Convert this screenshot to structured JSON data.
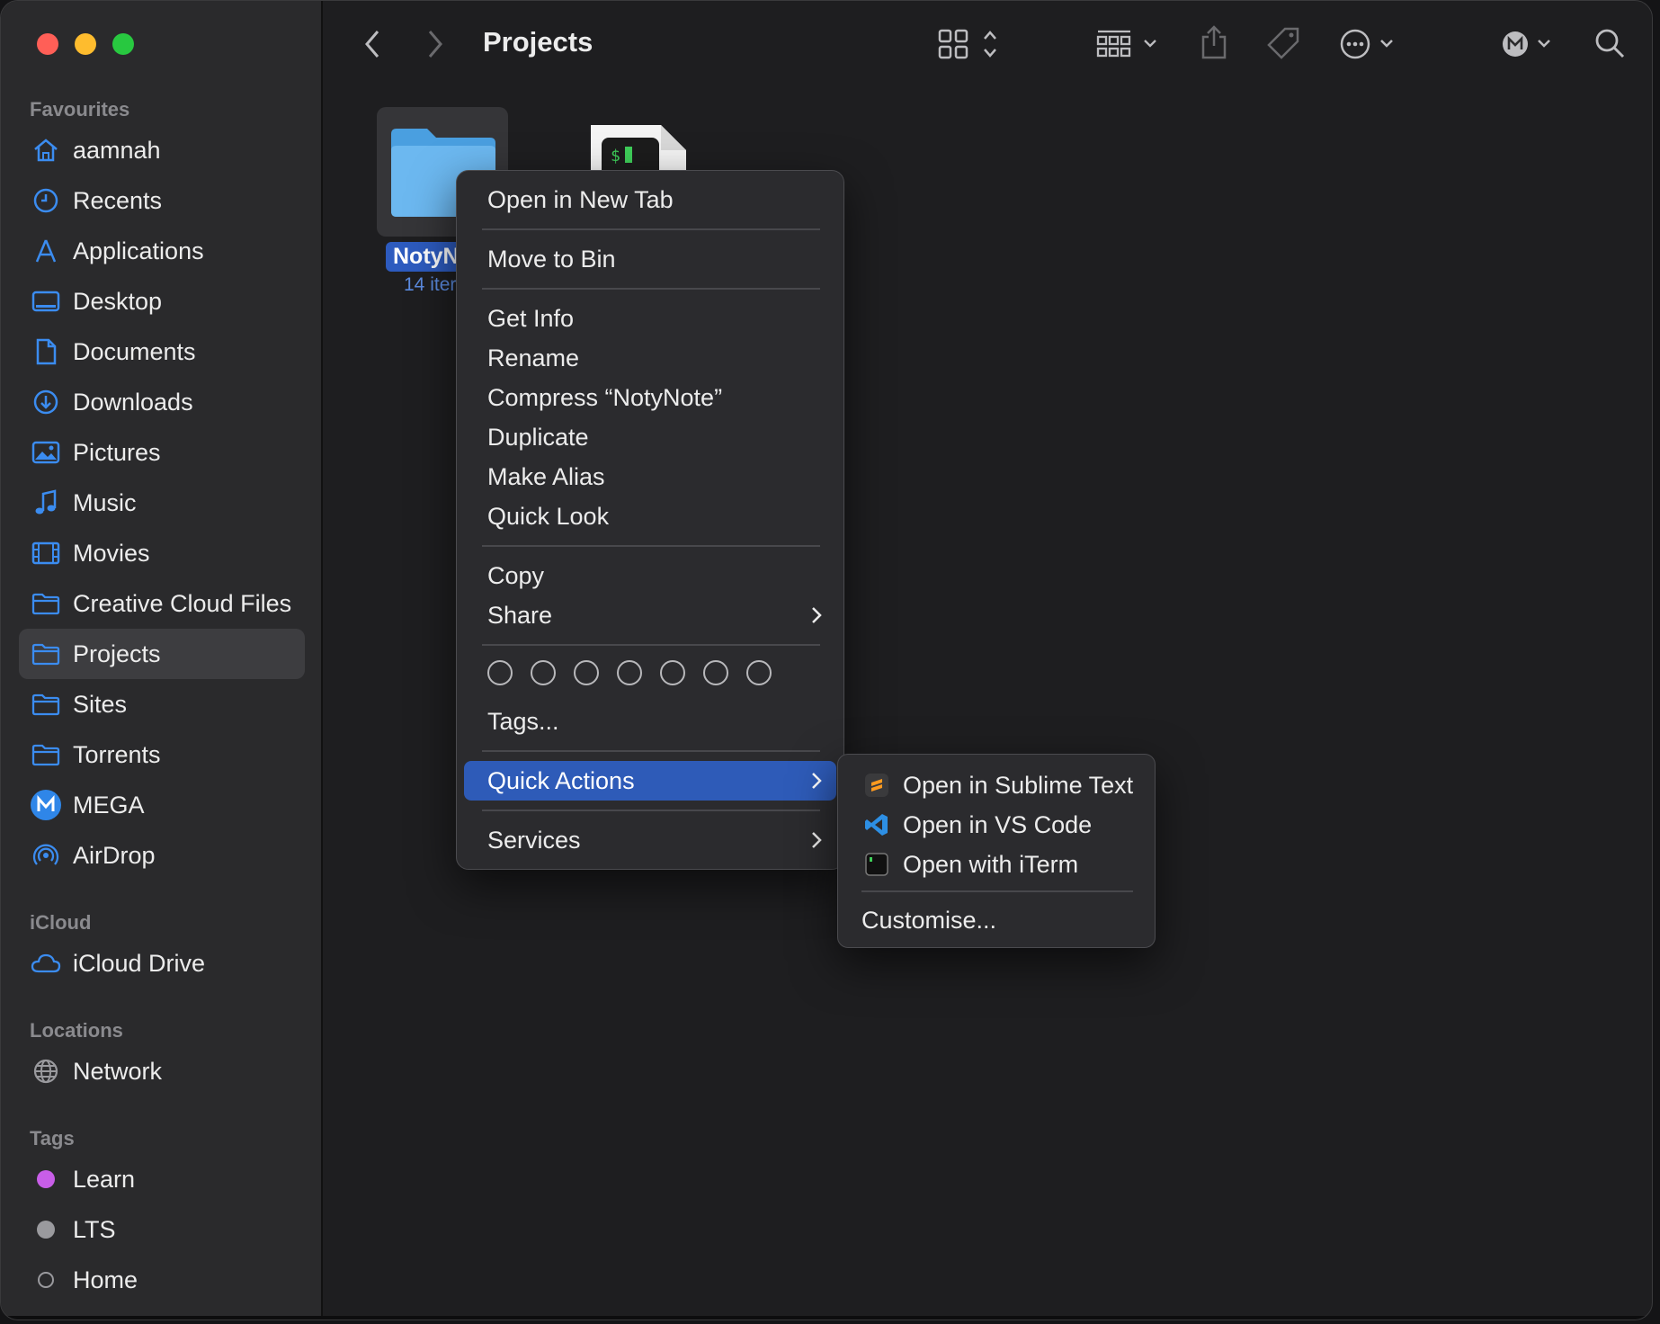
{
  "window": {
    "title": "Projects"
  },
  "sidebar": {
    "sections": {
      "favourites": "Favourites",
      "icloud": "iCloud",
      "locations": "Locations",
      "tags": "Tags"
    },
    "favourites": [
      {
        "label": "aamnah",
        "icon": "house-icon"
      },
      {
        "label": "Recents",
        "icon": "clock-icon"
      },
      {
        "label": "Applications",
        "icon": "applications-icon"
      },
      {
        "label": "Desktop",
        "icon": "desktop-icon"
      },
      {
        "label": "Documents",
        "icon": "document-icon"
      },
      {
        "label": "Downloads",
        "icon": "download-icon"
      },
      {
        "label": "Pictures",
        "icon": "photo-icon"
      },
      {
        "label": "Music",
        "icon": "music-note-icon"
      },
      {
        "label": "Movies",
        "icon": "film-icon"
      },
      {
        "label": "Creative Cloud Files",
        "icon": "folder-icon"
      },
      {
        "label": "Projects",
        "icon": "folder-icon",
        "selected": true
      },
      {
        "label": "Sites",
        "icon": "folder-icon"
      },
      {
        "label": "Torrents",
        "icon": "folder-icon"
      },
      {
        "label": "MEGA",
        "icon": "mega-icon"
      },
      {
        "label": "AirDrop",
        "icon": "airdrop-icon"
      }
    ],
    "icloud": [
      {
        "label": "iCloud Drive",
        "icon": "cloud-icon"
      }
    ],
    "locations": [
      {
        "label": "Network",
        "icon": "globe-icon"
      }
    ],
    "tags": [
      {
        "label": "Learn",
        "color": "#c85ee8"
      },
      {
        "label": "LTS",
        "color": "#9a9a9e"
      },
      {
        "label": "Home",
        "color": ""
      }
    ]
  },
  "toolbar": {
    "title": "Projects",
    "icons": [
      "back-icon",
      "forward-icon",
      "grid-view-icon",
      "group-icon",
      "share-icon",
      "tag-icon",
      "more-icon",
      "mega-toolbar-icon",
      "search-icon"
    ]
  },
  "content": {
    "folder": {
      "name": "NotyN",
      "count": "14 iter"
    }
  },
  "context_menu": {
    "items": {
      "open_new_tab": "Open in New Tab",
      "move_to_bin": "Move to Bin",
      "get_info": "Get Info",
      "rename": "Rename",
      "compress": "Compress “NotyNote”",
      "duplicate": "Duplicate",
      "make_alias": "Make Alias",
      "quick_look": "Quick Look",
      "copy": "Copy",
      "share": "Share",
      "tags": "Tags...",
      "quick_actions": "Quick Actions",
      "services": "Services"
    }
  },
  "submenu": {
    "items": {
      "sublime": "Open in Sublime Text",
      "vscode": "Open in VS Code",
      "iterm": "Open with iTerm",
      "customise": "Customise..."
    }
  },
  "colors": {
    "accent": "#2e5bb8",
    "sidebar_icon": "#3b8cf0"
  }
}
